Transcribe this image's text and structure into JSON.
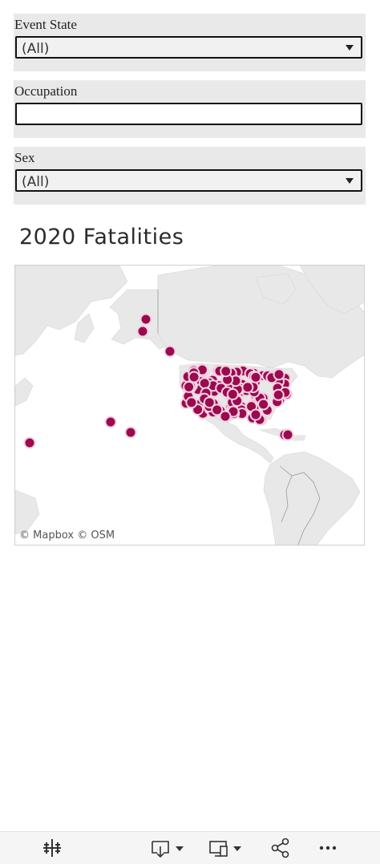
{
  "filters": {
    "event_state": {
      "label": "Event State",
      "value": "(All)"
    },
    "occupation": {
      "label": "Occupation",
      "value": ""
    },
    "sex": {
      "label": "Sex",
      "value": "(All)"
    }
  },
  "map": {
    "title": "2020 Fatalities",
    "attribution": "© Mapbox  © OSM",
    "marker_color": "#9b0a4f",
    "land_color": "#e8e8e8",
    "water_color": "#ffffff"
  },
  "toolbar": {
    "icons": [
      "tableau-logo-icon",
      "download-icon",
      "device-preview-icon",
      "share-icon",
      "more-icon"
    ]
  }
}
